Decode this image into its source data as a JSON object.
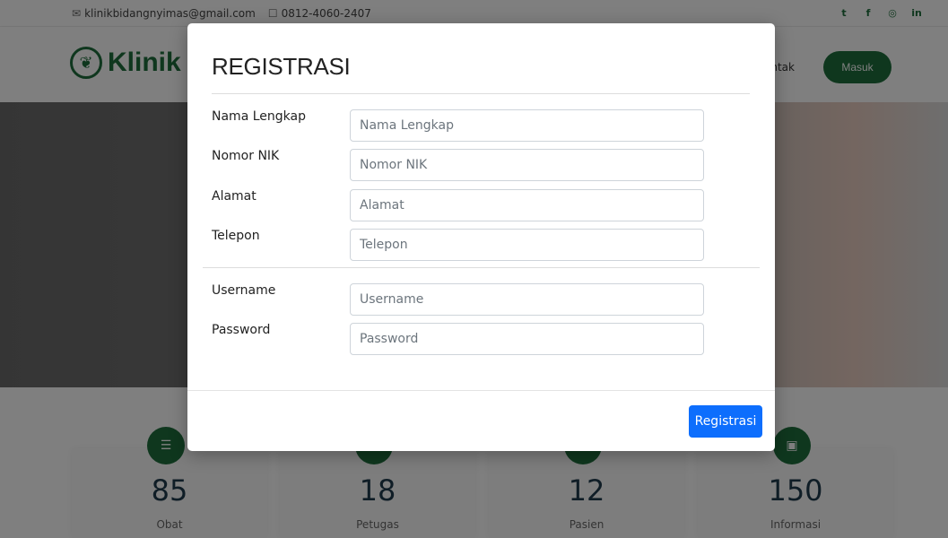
{
  "topbar": {
    "email": "klinikbidangnyimas@gmail.com",
    "phone": "0812-4060-2407",
    "social": [
      "twitter-icon",
      "facebook-icon",
      "instagram-icon",
      "linkedin-icon"
    ]
  },
  "navbar": {
    "brand": "Klinik B",
    "partial_link": "ontak",
    "login_label": "Masuk"
  },
  "stats": [
    {
      "value": "85",
      "label": "Obat",
      "icon": "list-icon"
    },
    {
      "value": "18",
      "label": "Petugas",
      "icon": "box-icon"
    },
    {
      "value": "12",
      "label": "Pasien",
      "icon": "user-icon"
    },
    {
      "value": "150",
      "label": "Informasi",
      "icon": "image-icon"
    }
  ],
  "modal": {
    "title": "REGISTRASI",
    "fields": [
      {
        "label": "Nama Lengkap",
        "placeholder": "Nama Lengkap",
        "value": ""
      },
      {
        "label": "Nomor NIK",
        "placeholder": "Nomor NIK",
        "value": ""
      },
      {
        "label": "Alamat",
        "placeholder": "Alamat",
        "value": ""
      },
      {
        "label": "Telepon",
        "placeholder": "Telepon",
        "value": ""
      },
      {
        "label": "Username",
        "placeholder": "Username",
        "value": ""
      },
      {
        "label": "Password",
        "placeholder": "Password",
        "value": ""
      }
    ],
    "submit_label": "Registrasi"
  },
  "colors": {
    "brand_green": "#1e6f3c",
    "primary_blue": "#0d6efd"
  }
}
